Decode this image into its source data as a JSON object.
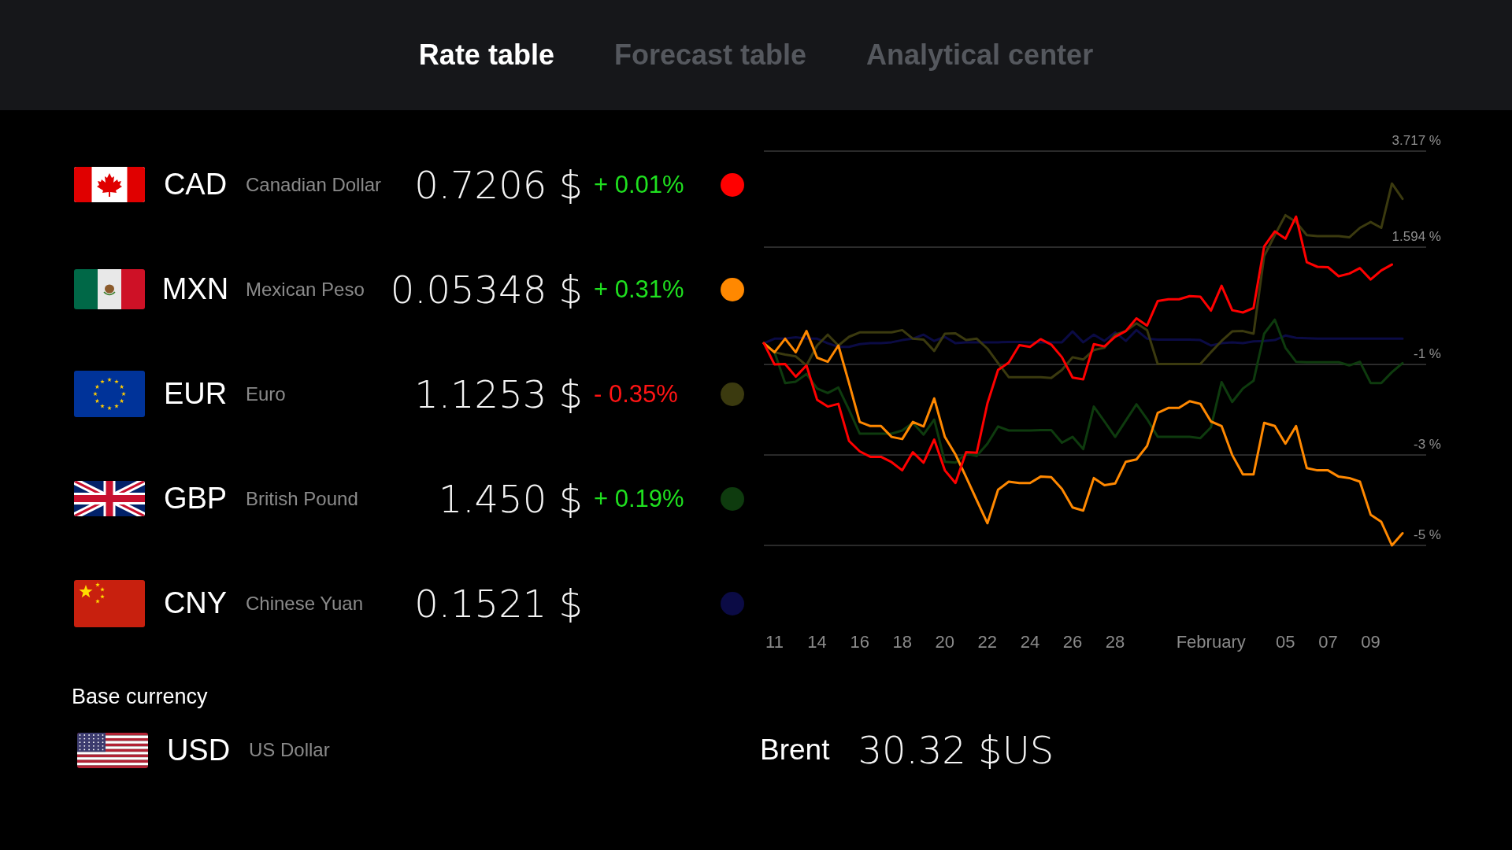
{
  "tabs": [
    {
      "label": "Rate table",
      "selected": true
    },
    {
      "label": "Forecast table",
      "selected": false
    },
    {
      "label": "Analytical center",
      "selected": false
    }
  ],
  "currencies": [
    {
      "code": "CAD",
      "name": "Canadian Dollar",
      "rate": "0.7206 $",
      "change": {
        "text": "+ 0.01%",
        "positive": true
      },
      "color": "#ff0000"
    },
    {
      "code": "MXN",
      "name": "Mexican Peso",
      "rate": "0.05348 $",
      "change": {
        "text": "+ 0.31%",
        "positive": true
      },
      "color": "#ff8800"
    },
    {
      "code": "EUR",
      "name": "Euro",
      "rate": "1.1253 $",
      "change": {
        "text": "- 0.35%",
        "positive": false
      },
      "color": "#3b3a0f"
    },
    {
      "code": "GBP",
      "name": "British Pound",
      "rate": "1.450 $",
      "change": {
        "text": "+ 0.19%",
        "positive": true
      },
      "color": "#0e3b0e"
    },
    {
      "code": "CNY",
      "name": "Chinese Yuan",
      "rate": "0.1521 $",
      "color": "#0b0b45"
    }
  ],
  "base_currency": {
    "label": "Base currency",
    "code": "USD",
    "name": "US Dollar"
  },
  "rate_chart": {
    "chart_data": [
      {
        "type": "line",
        "categories": [
          null,
          "11",
          null,
          null,
          null,
          "14",
          null,
          null,
          null,
          "16",
          null,
          null,
          null,
          "18",
          null,
          null,
          null,
          "20",
          null,
          null,
          null,
          "22",
          null,
          null,
          null,
          "24",
          null,
          null,
          null,
          "26",
          null,
          null,
          null,
          "28",
          null,
          null,
          null,
          null,
          null,
          null,
          null,
          null,
          "February",
          null,
          null,
          null,
          null,
          null,
          null,
          "05",
          null,
          null,
          null,
          "07",
          null,
          null,
          null,
          "09",
          null,
          null,
          null
        ],
        "series": [
          {
            "color": "#ff0000",
            "values": [
              -0.53,
              -1.0,
              -0.99,
              -1.27,
              -1.02,
              -1.78,
              -1.93,
              -1.87,
              -2.69,
              -2.92,
              -3.04,
              -3.04,
              -3.16,
              -3.34,
              -2.94,
              -3.17,
              -2.66,
              -3.34,
              -3.62,
              -2.94,
              -2.95,
              -1.86,
              -1.12,
              -0.96,
              -0.57,
              -0.61,
              -0.44,
              -0.56,
              -0.84,
              -1.29,
              -1.33,
              -0.55,
              -0.6,
              -0.39,
              -0.26,
              0.02,
              -0.14,
              0.4,
              0.44,
              0.44,
              0.51,
              0.5,
              0.19,
              0.74,
              0.2,
              0.15,
              0.25,
              1.61,
              1.94,
              1.78,
              2.27,
              1.26,
              1.16,
              1.15,
              0.95,
              1.01,
              1.13,
              0.88,
              1.08,
              1.21,
              null
            ]
          },
          {
            "color": "#ff8800",
            "values": [
              -0.53,
              -0.73,
              -0.43,
              -0.73,
              -0.26,
              -0.85,
              -0.94,
              -0.58,
              -1.41,
              -2.27,
              -2.36,
              -2.36,
              -2.6,
              -2.65,
              -2.27,
              -2.37,
              -1.75,
              -2.6,
              -2.99,
              -3.49,
              -4.0,
              -4.51,
              -3.77,
              -3.59,
              -3.62,
              -3.62,
              -3.48,
              -3.49,
              -3.75,
              -4.16,
              -4.23,
              -3.51,
              -3.67,
              -3.63,
              -3.15,
              -3.1,
              -2.8,
              -2.07,
              -1.96,
              -1.96,
              -1.81,
              -1.87,
              -2.26,
              -2.36,
              -3.0,
              -3.43,
              -3.43,
              -2.29,
              -2.36,
              -2.75,
              -2.36,
              -3.29,
              -3.34,
              -3.34,
              -3.48,
              -3.51,
              -3.59,
              -4.32,
              -4.48,
              -5.0,
              -4.73
            ]
          },
          {
            "color": "#3b3a0f",
            "values": [
              -0.53,
              -0.73,
              -0.78,
              -0.82,
              -1.02,
              -0.58,
              -0.34,
              -0.58,
              -0.39,
              -0.29,
              -0.29,
              -0.29,
              -0.29,
              -0.24,
              -0.43,
              -0.45,
              -0.7,
              -0.32,
              -0.31,
              -0.46,
              -0.43,
              -0.65,
              -0.97,
              -1.28,
              -1.28,
              -1.28,
              -1.28,
              -1.3,
              -1.12,
              -0.84,
              -0.89,
              -0.68,
              -0.63,
              -0.34,
              -0.26,
              -0.09,
              -0.24,
              -0.99,
              -0.99,
              -0.99,
              -0.99,
              -0.99,
              -0.73,
              -0.48,
              -0.27,
              -0.26,
              -0.32,
              1.4,
              1.86,
              2.3,
              2.15,
              1.86,
              1.84,
              1.84,
              1.84,
              1.81,
              2.02,
              2.15,
              2.02,
              3.0,
              2.66
            ]
          },
          {
            "color": "#0e3b0e",
            "values": [
              -0.53,
              -0.73,
              -1.41,
              -1.38,
              -1.21,
              -1.53,
              -1.63,
              -1.51,
              -2.0,
              -2.53,
              -2.53,
              -2.53,
              -2.53,
              -2.46,
              -2.29,
              -2.55,
              -2.22,
              -3.15,
              -3.17,
              -2.97,
              -3.02,
              -2.75,
              -2.37,
              -2.46,
              -2.46,
              -2.46,
              -2.45,
              -2.45,
              -2.73,
              -2.6,
              -2.87,
              -1.93,
              -2.26,
              -2.6,
              -2.24,
              -1.88,
              -2.21,
              -2.6,
              -2.6,
              -2.6,
              -2.6,
              -2.63,
              -2.39,
              -1.39,
              -1.83,
              -1.53,
              -1.36,
              -0.32,
              -0.01,
              -0.63,
              -0.94,
              -0.95,
              -0.95,
              -0.95,
              -0.95,
              -1.02,
              -0.94,
              -1.41,
              -1.41,
              -1.17,
              -0.97
            ]
          },
          {
            "color": "#0b0b45",
            "values": [
              -0.53,
              -0.43,
              -0.43,
              -0.4,
              -0.43,
              -0.43,
              -0.53,
              -0.61,
              -0.61,
              -0.55,
              -0.53,
              -0.53,
              -0.51,
              -0.46,
              -0.43,
              -0.34,
              -0.48,
              -0.39,
              -0.53,
              -0.51,
              -0.51,
              -0.51,
              -0.51,
              -0.5,
              -0.5,
              -0.51,
              -0.51,
              -0.51,
              -0.51,
              -0.27,
              -0.51,
              -0.34,
              -0.48,
              -0.29,
              -0.48,
              -0.24,
              -0.43,
              -0.45,
              -0.45,
              -0.45,
              -0.45,
              -0.46,
              -0.58,
              -0.53,
              -0.51,
              -0.53,
              -0.49,
              -0.48,
              -0.46,
              -0.36,
              -0.41,
              -0.42,
              -0.43,
              -0.43,
              -0.43,
              -0.43,
              -0.43,
              -0.43,
              -0.43,
              -0.43,
              -0.43
            ]
          }
        ],
        "yticks": [
          {
            "value": 3.717,
            "label": "3.717 %"
          },
          {
            "value": 1.594,
            "label": "1.594 %"
          },
          {
            "value": -1,
            "label": "-1 %"
          },
          {
            "value": -3,
            "label": "-3 %"
          },
          {
            "value": -5,
            "label": "-5 %"
          }
        ],
        "ylim": [
          -5,
          3.717
        ],
        "grid": true
      }
    ]
  },
  "brent": {
    "label": "Brent",
    "price": "30.32 $US"
  }
}
